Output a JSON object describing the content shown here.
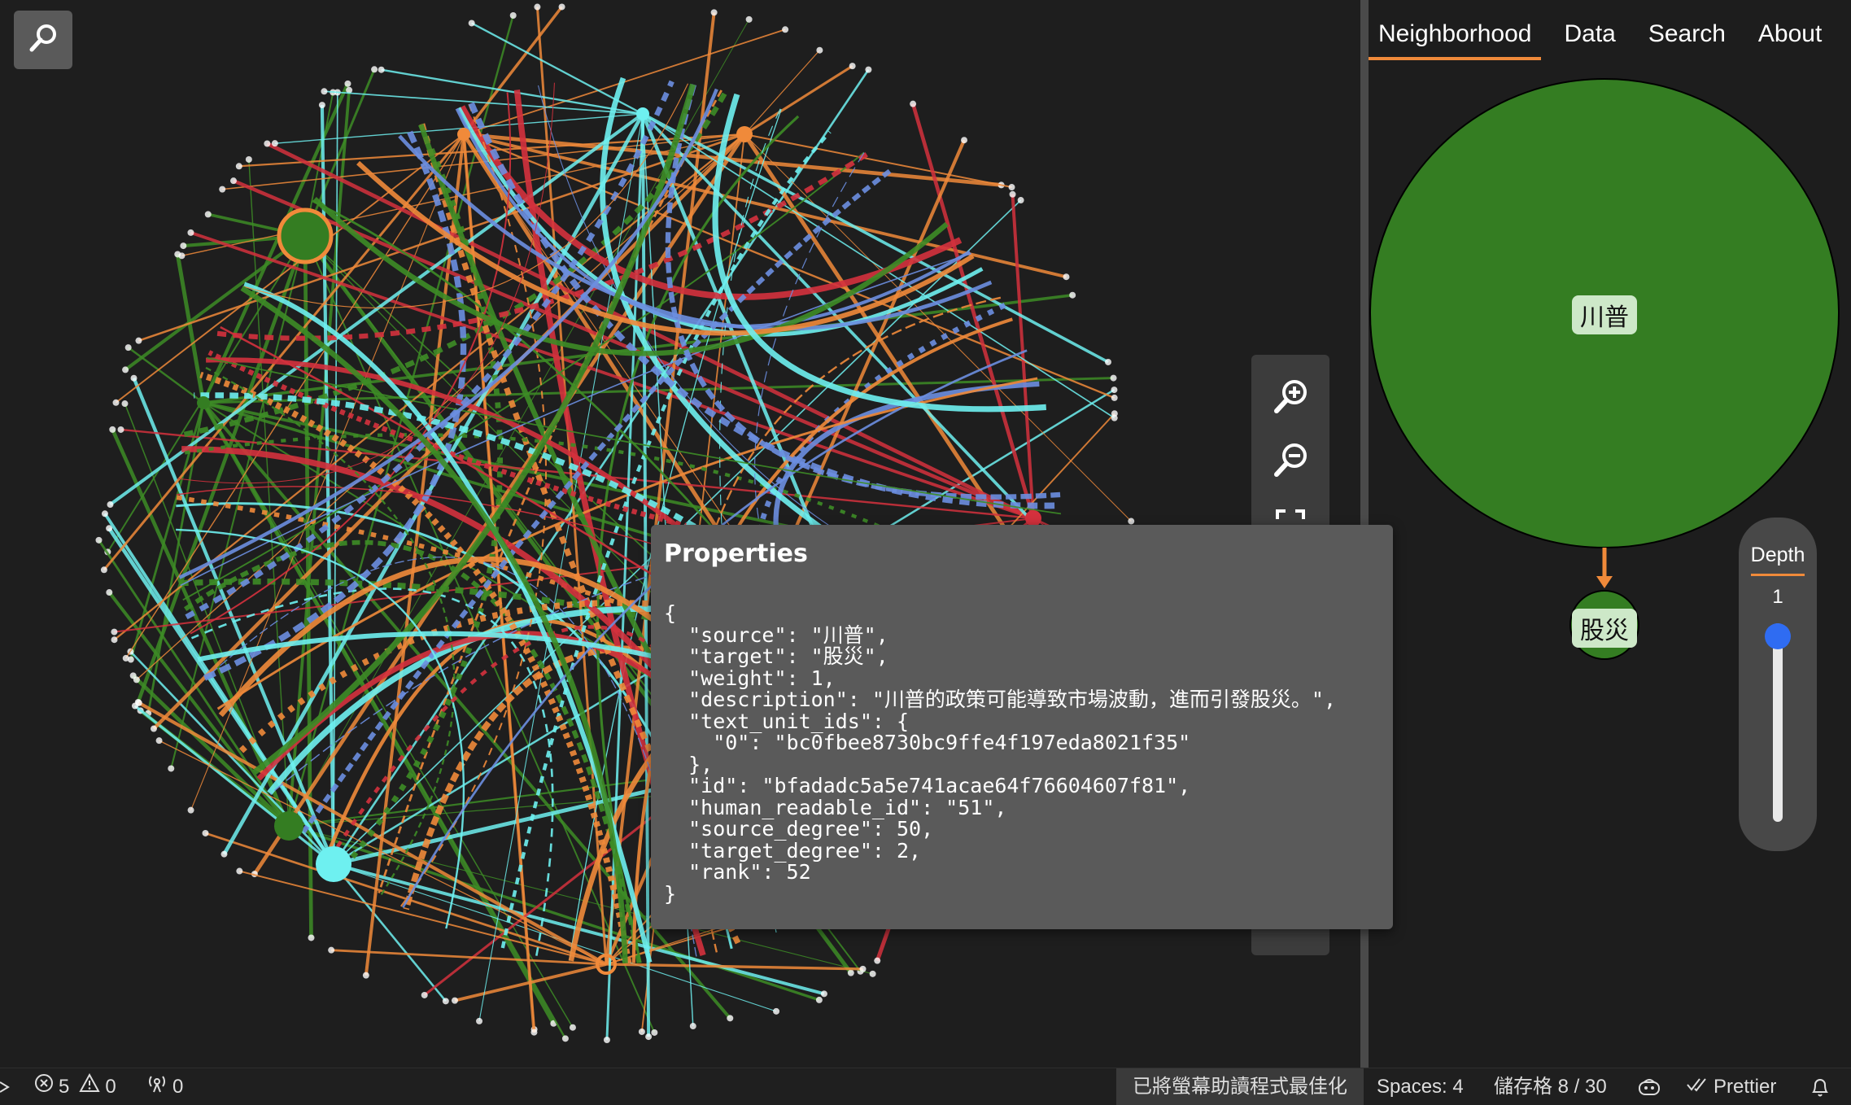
{
  "toolbar": {
    "search_icon": "search-icon"
  },
  "zoom": {
    "zoom_in_icon": "zoom-in-icon",
    "zoom_out_icon": "zoom-out-icon",
    "fit_icon": "fullscreen-icon"
  },
  "tabs": [
    {
      "label": "Neighborhood",
      "active": true
    },
    {
      "label": "Data",
      "active": false
    },
    {
      "label": "Search",
      "active": false
    },
    {
      "label": "About",
      "active": false
    }
  ],
  "neighborhood": {
    "source_node": "川普",
    "target_node": "股災",
    "node_color": "#347d22",
    "edge_color": "#f08a3a"
  },
  "depth": {
    "title": "Depth",
    "value": "1"
  },
  "properties": {
    "title": "Properties",
    "json_text": "{\n  \"source\": \"川普\",\n  \"target\": \"股災\",\n  \"weight\": 1,\n  \"description\": \"川普的政策可能導致市場波動，進而引發股災。\",\n  \"text_unit_ids\": {\n    \"0\": \"bc0fbee8730bc9ffe4f197eda8021f35\"\n  },\n  \"id\": \"bfadadc5a5e741acae64f76604607f81\",\n  \"human_readable_id\": \"51\",\n  \"source_degree\": 50,\n  \"target_degree\": 2,\n  \"rank\": 52\n}"
  },
  "statusbar": {
    "errors": "5",
    "warnings": "0",
    "ports": "0",
    "screen_reader": "已將螢幕助讀程式最佳化",
    "spaces": "Spaces: 4",
    "cell": "儲存格 8 / 30",
    "prettier": "Prettier"
  },
  "graph_colors": [
    "#3d8c26",
    "#f08a3a",
    "#6ef0f0",
    "#d4313d",
    "#6c8ee0",
    "#7a2fb0"
  ]
}
